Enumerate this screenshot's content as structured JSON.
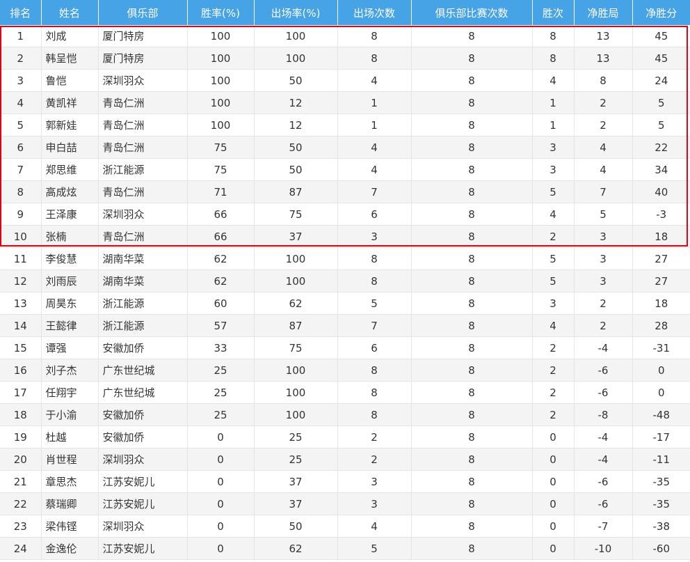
{
  "columns": [
    "排名",
    "姓名",
    "俱乐部",
    "胜率(%)",
    "出场率(%)",
    "出场次数",
    "俱乐部比赛次数",
    "胜次",
    "净胜局",
    "净胜分"
  ],
  "highlight_color": "#e60012",
  "header_color": "#45a3e6",
  "rows": [
    [
      "1",
      "刘成",
      "厦门特房",
      "100",
      "100",
      "8",
      "8",
      "8",
      "13",
      "45"
    ],
    [
      "2",
      "韩呈恺",
      "厦门特房",
      "100",
      "100",
      "8",
      "8",
      "8",
      "13",
      "45"
    ],
    [
      "3",
      "鲁恺",
      "深圳羽众",
      "100",
      "50",
      "4",
      "8",
      "4",
      "8",
      "24"
    ],
    [
      "4",
      "黄凯祥",
      "青岛仁洲",
      "100",
      "12",
      "1",
      "8",
      "1",
      "2",
      "5"
    ],
    [
      "5",
      "郭新娃",
      "青岛仁洲",
      "100",
      "12",
      "1",
      "8",
      "1",
      "2",
      "5"
    ],
    [
      "6",
      "申白喆",
      "青岛仁洲",
      "75",
      "50",
      "4",
      "8",
      "3",
      "4",
      "22"
    ],
    [
      "7",
      "郑思维",
      "浙江能源",
      "75",
      "50",
      "4",
      "8",
      "3",
      "4",
      "34"
    ],
    [
      "8",
      "高成炫",
      "青岛仁洲",
      "71",
      "87",
      "7",
      "8",
      "5",
      "7",
      "40"
    ],
    [
      "9",
      "王泽康",
      "深圳羽众",
      "66",
      "75",
      "6",
      "8",
      "4",
      "5",
      "-3"
    ],
    [
      "10",
      "张楠",
      "青岛仁洲",
      "66",
      "37",
      "3",
      "8",
      "2",
      "3",
      "18"
    ],
    [
      "11",
      "李俊慧",
      "湖南华菜",
      "62",
      "100",
      "8",
      "8",
      "5",
      "3",
      "27"
    ],
    [
      "12",
      "刘雨辰",
      "湖南华菜",
      "62",
      "100",
      "8",
      "8",
      "5",
      "3",
      "27"
    ],
    [
      "13",
      "周昊东",
      "浙江能源",
      "60",
      "62",
      "5",
      "8",
      "3",
      "2",
      "18"
    ],
    [
      "14",
      "王懿律",
      "浙江能源",
      "57",
      "87",
      "7",
      "8",
      "4",
      "2",
      "28"
    ],
    [
      "15",
      "谭强",
      "安徽加侨",
      "33",
      "75",
      "6",
      "8",
      "2",
      "-4",
      "-31"
    ],
    [
      "16",
      "刘子杰",
      "广东世纪城",
      "25",
      "100",
      "8",
      "8",
      "2",
      "-6",
      "0"
    ],
    [
      "17",
      "任翔宇",
      "广东世纪城",
      "25",
      "100",
      "8",
      "8",
      "2",
      "-6",
      "0"
    ],
    [
      "18",
      "于小渝",
      "安徽加侨",
      "25",
      "100",
      "8",
      "8",
      "2",
      "-8",
      "-48"
    ],
    [
      "19",
      "杜越",
      "安徽加侨",
      "0",
      "25",
      "2",
      "8",
      "0",
      "-4",
      "-17"
    ],
    [
      "20",
      "肖世程",
      "深圳羽众",
      "0",
      "25",
      "2",
      "8",
      "0",
      "-4",
      "-11"
    ],
    [
      "21",
      "章思杰",
      "江苏安妮儿",
      "0",
      "37",
      "3",
      "8",
      "0",
      "-6",
      "-35"
    ],
    [
      "22",
      "蔡瑞卿",
      "江苏安妮儿",
      "0",
      "37",
      "3",
      "8",
      "0",
      "-6",
      "-35"
    ],
    [
      "23",
      "梁伟铿",
      "深圳羽众",
      "0",
      "50",
      "4",
      "8",
      "0",
      "-7",
      "-38"
    ],
    [
      "24",
      "金逸伦",
      "江苏安妮儿",
      "0",
      "62",
      "5",
      "8",
      "0",
      "-10",
      "-60"
    ]
  ]
}
